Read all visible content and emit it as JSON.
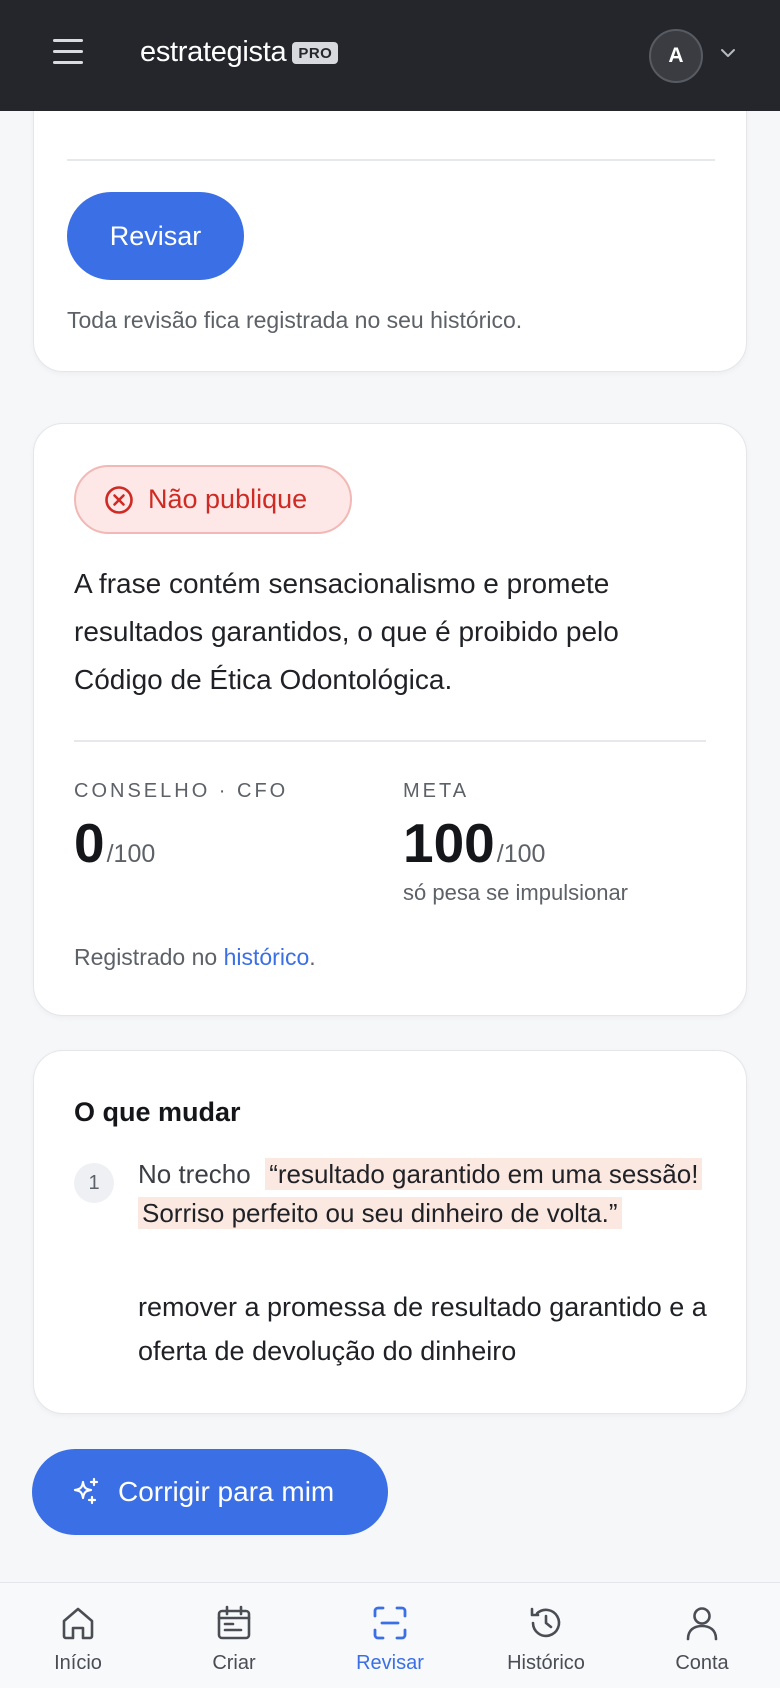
{
  "header": {
    "brand": "estrategista",
    "brand_badge": "PRO",
    "avatar_initial": "A"
  },
  "review_form": {
    "button_label": "Revisar",
    "note": "Toda revisão fica registrada no seu histórico."
  },
  "result": {
    "status_label": "Não publique",
    "verdict": "A frase contém sensacionalismo e promete resultados garantidos, o que é proibido pelo Código de Ética Odontológica.",
    "council": {
      "label": "CONSELHO · CFO",
      "score": "0",
      "max": "/100"
    },
    "meta": {
      "label": "META",
      "score": "100",
      "max": "/100",
      "note": "só pesa se impulsionar"
    },
    "registered_prefix": "Registrado no ",
    "registered_link": "histórico",
    "registered_suffix": "."
  },
  "changes": {
    "title": "O que mudar",
    "items": [
      {
        "number": "1",
        "prefix": "No trecho",
        "quote": "“resultado garantido em uma sessão! Sorriso perfeito ou seu dinheiro de volta.”",
        "action": "remover a promessa de resultado garantido e a oferta de devolução do dinheiro"
      }
    ]
  },
  "fix_button": {
    "label": "Corrigir para mim"
  },
  "bottom_nav": {
    "items": [
      {
        "label": "Início",
        "icon": "home-icon"
      },
      {
        "label": "Criar",
        "icon": "calendar-icon"
      },
      {
        "label": "Revisar",
        "icon": "scan-icon",
        "active": true
      },
      {
        "label": "Histórico",
        "icon": "history-icon"
      },
      {
        "label": "Conta",
        "icon": "user-icon"
      }
    ]
  },
  "colors": {
    "primary": "#3b6fe6",
    "header_bg": "#24262c",
    "danger": "#cf2a23",
    "danger_bg": "#fde8e7",
    "quote_bg": "#fbe9e1"
  }
}
